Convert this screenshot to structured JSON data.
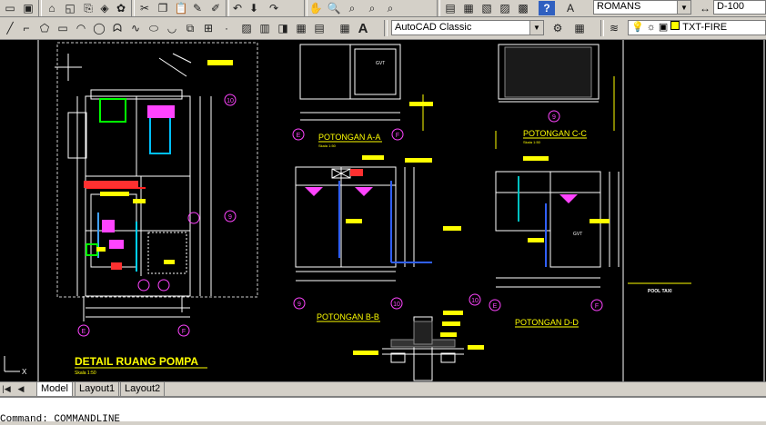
{
  "toolbar": {
    "text_style": "ROMANS",
    "dim_style": "D-100",
    "workspace": "AutoCAD Classic",
    "layer": "TXT-FIRE",
    "text_tool": "A",
    "help": "?"
  },
  "drawing": {
    "title_main": "DETAIL RUANG POMPA",
    "scale_main": "Skala 1:50",
    "sec_aa": "POTONGAN A-A",
    "sec_bb": "POTONGAN B-B",
    "sec_cc": "POTONGAN C-C",
    "sec_dd": "POTONGAN D-D",
    "scale_aa": "Skala 1:50",
    "scale_cc": "Skala 1:50",
    "pool_taxi": "POOL TAXI",
    "gvt": "GVT",
    "grid_e": "E",
    "grid_f": "F",
    "grid_9": "9",
    "grid_10": "10",
    "ucs_x": "X"
  },
  "tabs": {
    "model": "Model",
    "layout1": "Layout1",
    "layout2": "Layout2"
  },
  "command": {
    "line": "Command: COMMANDLINE"
  }
}
